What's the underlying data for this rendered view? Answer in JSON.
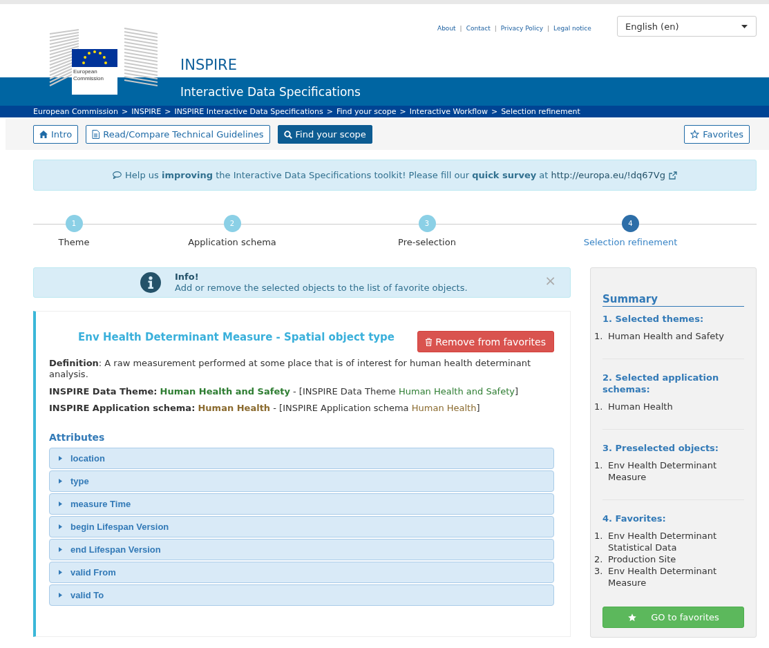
{
  "header": {
    "logo_text": "European Commission",
    "site_title": "INSPIRE",
    "subtitle": "Interactive Data Specifications",
    "top_links": [
      "About",
      "Contact",
      "Privacy Policy",
      "Legal notice"
    ],
    "link_separator": "|",
    "language": {
      "value": "English (en)"
    },
    "breadcrumb": {
      "separator": ">",
      "items": [
        "European Commission",
        "INSPIRE",
        "INSPIRE Interactive Data Specifications",
        "Find your scope",
        "Interactive Workflow",
        "Selection refinement"
      ]
    }
  },
  "nav": {
    "buttons": [
      {
        "label": "Intro",
        "selected": false
      },
      {
        "label": "Read/Compare Technical Guidelines",
        "selected": false
      },
      {
        "label": "Find your scope",
        "selected": true
      }
    ],
    "favorites": {
      "label": "Favorites"
    }
  },
  "survey": {
    "text": "Help us **improving** the Interactive Data Specifications toolkit! Please fill our **quick survey** at",
    "link": "http://europa.eu/!dq67Vg"
  },
  "steps": [
    {
      "number": "1",
      "label": "Theme",
      "selected": false
    },
    {
      "number": "2",
      "label": "Application schema",
      "selected": false
    },
    {
      "number": "3",
      "label": "Pre-selection",
      "selected": false
    },
    {
      "number": "4",
      "label": "Selection refinement",
      "selected": true
    }
  ],
  "info": {
    "title": "Info!",
    "text": "Add or remove the selected objects to the list of favorite objects.",
    "close": "×"
  },
  "object": {
    "title": "Env Health Determinant Measure - Spatial object type",
    "remove_button": "Remove from favorites",
    "definition": "**Definition**: A raw measurement performed at some place that is of interest for human health determinant analysis.",
    "relations": [
      {
        "color": "#2e7d32",
        "label": "INSPIRE Data Theme:",
        "value": "Human Health and Safety",
        "ref_open": "- [INSPIRE Data Theme",
        "ref_value": "Human Health and Safety",
        "ref_close": "]"
      },
      {
        "color": "#8a6a2e",
        "label": "INSPIRE Application schema:",
        "value": "Human Health",
        "ref_open": "- [INSPIRE Application schema",
        "ref_value": "Human Health",
        "ref_close": "]"
      }
    ],
    "attributes_heading": "Attributes",
    "attributes": [
      {
        "label": "location",
        "expanded": false
      },
      {
        "label": "type",
        "expanded": false
      },
      {
        "label": "measure Time",
        "expanded": false
      },
      {
        "label": "begin Lifespan Version",
        "expanded": false
      },
      {
        "label": "end Lifespan Version",
        "expanded": false
      },
      {
        "label": "valid From",
        "expanded": false
      },
      {
        "label": "valid To",
        "expanded": false
      }
    ]
  },
  "summary": {
    "title": "Summary",
    "sections": [
      {
        "heading": "1. Selected themes:",
        "items": [
          {
            "number": "1.",
            "text": "Human Health and Safety"
          }
        ]
      },
      {
        "heading": "2. Selected application schemas:",
        "items": [
          {
            "number": "1.",
            "text": "Human Health"
          }
        ]
      },
      {
        "heading": "3. Preselected objects:",
        "items": [
          {
            "number": "1.",
            "text": "Env Health Determinant Measure"
          }
        ]
      },
      {
        "heading": "4. Favorites:",
        "items": [
          {
            "number": "1.",
            "text": "Env Health Determinant Statistical Data"
          },
          {
            "number": "2.",
            "text": "Production Site"
          },
          {
            "number": "3.",
            "text": "Env Health Determinant Measure"
          }
        ]
      }
    ],
    "button": "GO to favorites"
  }
}
